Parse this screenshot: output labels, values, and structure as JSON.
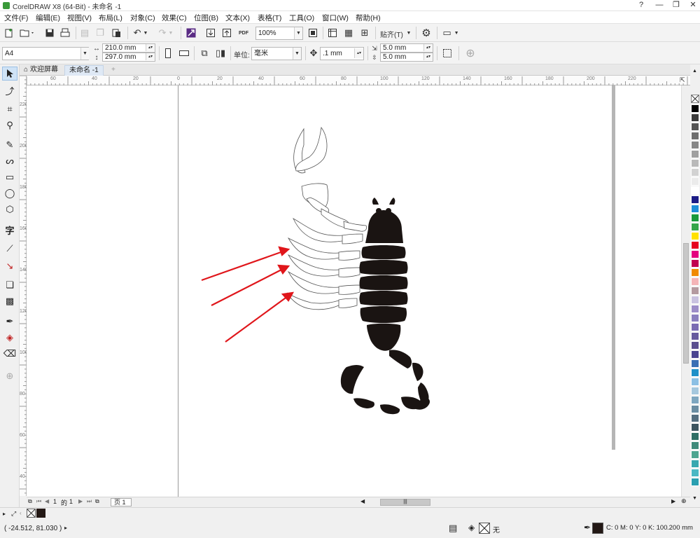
{
  "window": {
    "title": "CorelDRAW X8 (64-Bit) - 未命名 -1",
    "controls": [
      "?",
      "—",
      "❐",
      "✕"
    ]
  },
  "menu": [
    "文件(F)",
    "编辑(E)",
    "视图(V)",
    "布局(L)",
    "对象(C)",
    "效果(C)",
    "位图(B)",
    "文本(X)",
    "表格(T)",
    "工具(O)",
    "窗口(W)",
    "帮助(H)"
  ],
  "standard_toolbar": {
    "zoom": "100%",
    "snap_label": "贴齐(T)",
    "pdf_label": "PDF"
  },
  "property_bar": {
    "page_size": "A4",
    "width": "210.0 mm",
    "height": "297.0 mm",
    "units_label": "单位:",
    "units_value": "毫米",
    "nudge": ".1 mm",
    "dup_x": "5.0 mm",
    "dup_y": "5.0 mm"
  },
  "tabs": {
    "welcome": "欢迎屏幕",
    "document": "未命名 -1",
    "add": "+"
  },
  "hruler_labels": [
    "60",
    "40",
    "20",
    "0",
    "20",
    "40",
    "60",
    "80",
    "100",
    "120",
    "140",
    "160",
    "180",
    "200",
    "220"
  ],
  "vruler_labels": [
    "220",
    "200",
    "180",
    "160",
    "140",
    "120",
    "100",
    "80",
    "60",
    "40"
  ],
  "page_nav": {
    "current": "1",
    "of_label": "的",
    "total": "1",
    "page_tab": "页 1"
  },
  "status": {
    "coords": "( -24.512, 81.030 )",
    "fill_none": "无",
    "outline_color_text": "C: 0 M: 0 Y: 0 K: 100",
    "outline_width": ".200 mm"
  },
  "palette_colors": [
    "#000000",
    "#3c3c3c",
    "#555555",
    "#6e6e6e",
    "#878787",
    "#a0a0a0",
    "#b9b9b9",
    "#d2d2d2",
    "#ebebeb",
    "#ffffff",
    "#1b1c86",
    "#1f8fd8",
    "#1a9a3c",
    "#36a64a",
    "#ffe100",
    "#e6001f",
    "#e4007f",
    "#c0004f",
    "#f08a00",
    "#f4b4b7",
    "#b49aa0",
    "#c9c2e0",
    "#9d8dc8",
    "#8b7fbf",
    "#7a6bb3",
    "#675a9e",
    "#5b4f8f",
    "#4b4490",
    "#3b6fb4",
    "#1e90c8",
    "#8cc0e4",
    "#a5c8de",
    "#7ea7c0",
    "#6b8ea3",
    "#556f80",
    "#3d5560",
    "#2f6f66",
    "#3f8a7a",
    "#4ea590",
    "#38a8b0",
    "#4ab8c4",
    "#2b9fb0"
  ]
}
